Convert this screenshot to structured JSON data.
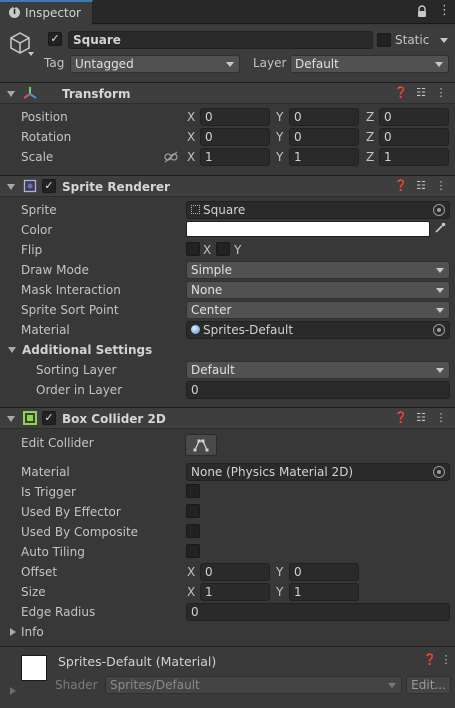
{
  "window": {
    "tab_label": "Inspector"
  },
  "object": {
    "name": "Square",
    "static_label": "Static",
    "tag_label": "Tag",
    "tag_value": "Untagged",
    "layer_label": "Layer",
    "layer_value": "Default"
  },
  "transform": {
    "title": "Transform",
    "position_label": "Position",
    "rotation_label": "Rotation",
    "scale_label": "Scale",
    "x": "X",
    "y": "Y",
    "z": "Z",
    "position": [
      "0",
      "0",
      "0"
    ],
    "rotation": [
      "0",
      "0",
      "0"
    ],
    "scale": [
      "1",
      "1",
      "1"
    ]
  },
  "sprite_renderer": {
    "title": "Sprite Renderer",
    "sprite_label": "Sprite",
    "sprite_value": "Square",
    "color_label": "Color",
    "color_value": "#ffffff",
    "flip_label": "Flip",
    "flip_x": "X",
    "flip_y": "Y",
    "draw_mode_label": "Draw Mode",
    "draw_mode_value": "Simple",
    "mask_label": "Mask Interaction",
    "mask_value": "None",
    "sort_point_label": "Sprite Sort Point",
    "sort_point_value": "Center",
    "material_label": "Material",
    "material_value": "Sprites-Default",
    "additional_label": "Additional Settings",
    "sorting_layer_label": "Sorting Layer",
    "sorting_layer_value": "Default",
    "order_label": "Order in Layer",
    "order_value": "0"
  },
  "box_collider": {
    "title": "Box Collider 2D",
    "edit_label": "Edit Collider",
    "material_label": "Material",
    "material_value": "None (Physics Material 2D)",
    "trigger_label": "Is Trigger",
    "effector_label": "Used By Effector",
    "composite_label": "Used By Composite",
    "autotiling_label": "Auto Tiling",
    "offset_label": "Offset",
    "offset": [
      "0",
      "0"
    ],
    "size_label": "Size",
    "size": [
      "1",
      "1"
    ],
    "x": "X",
    "y": "Y",
    "edge_label": "Edge Radius",
    "edge_value": "0",
    "info_label": "Info"
  },
  "material_preview": {
    "title": "Sprites-Default (Material)",
    "shader_label": "Shader",
    "shader_value": "Sprites/Default",
    "edit_label": "Edit..."
  }
}
